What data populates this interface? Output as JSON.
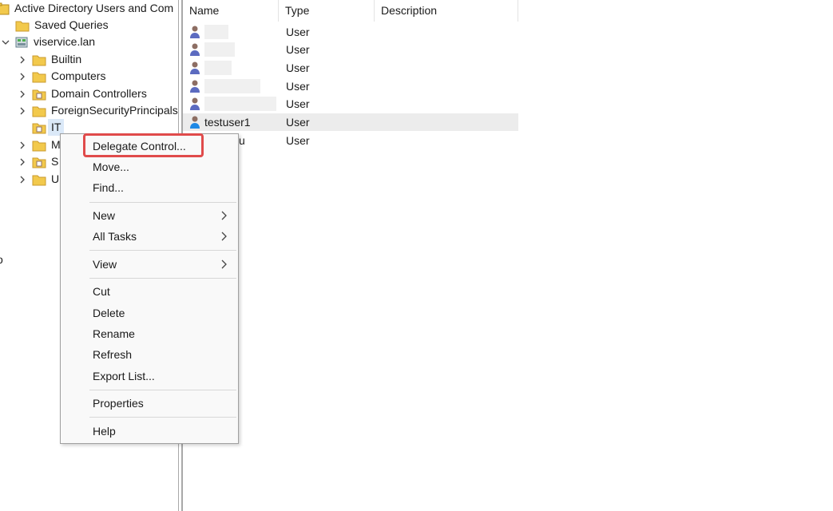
{
  "tree": {
    "root_label": "Active Directory Users and Com",
    "items": [
      {
        "label": "Saved Queries"
      },
      {
        "label": "viservice.lan"
      },
      {
        "label": "Builtin"
      },
      {
        "label": "Computers"
      },
      {
        "label": "Domain Controllers"
      },
      {
        "label": "ForeignSecurityPrincipals"
      },
      {
        "label": "IT"
      },
      {
        "label": "M"
      },
      {
        "label": "S"
      },
      {
        "label": "U"
      }
    ],
    "side_glyph": "o"
  },
  "list": {
    "columns": [
      "Name",
      "Type",
      "Description"
    ],
    "rows": [
      {
        "name": "",
        "type": "User"
      },
      {
        "name": "",
        "type": "User"
      },
      {
        "name": "",
        "type": "User"
      },
      {
        "name": "",
        "type": "User"
      },
      {
        "name": "",
        "type": "User"
      },
      {
        "name": "testuser1",
        "type": "User"
      },
      {
        "name": ".wu",
        "type": "User"
      }
    ]
  },
  "context_menu": {
    "items": [
      {
        "label": "Delegate Control..."
      },
      {
        "label": "Move..."
      },
      {
        "label": "Find..."
      },
      {
        "label": "New"
      },
      {
        "label": "All Tasks"
      },
      {
        "label": "View"
      },
      {
        "label": "Cut"
      },
      {
        "label": "Delete"
      },
      {
        "label": "Rename"
      },
      {
        "label": "Refresh"
      },
      {
        "label": "Export List..."
      },
      {
        "label": "Properties"
      },
      {
        "label": "Help"
      }
    ]
  },
  "colors": {
    "highlight_box": "#e04b4b",
    "selection": "#dbe9f8",
    "menu_bg": "#f9f9f9",
    "folder": "#f2c94c"
  }
}
